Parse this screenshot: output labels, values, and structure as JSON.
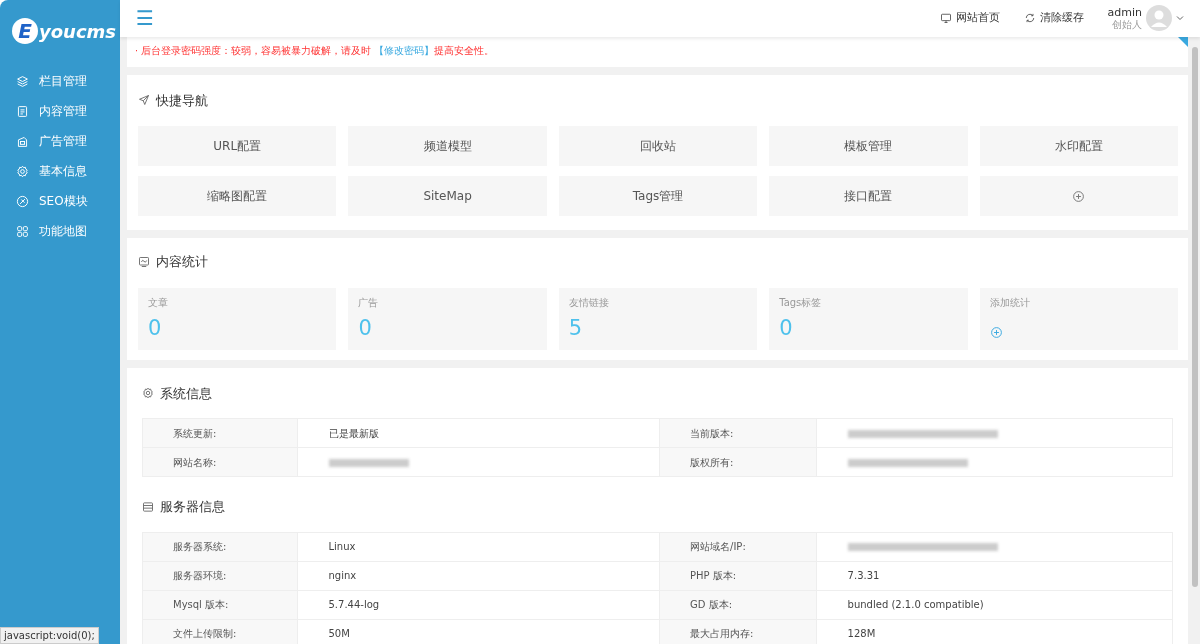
{
  "sidebar": {
    "logo": "youcms",
    "logo_letter": "E",
    "items": [
      {
        "label": "栏目管理",
        "selected": false
      },
      {
        "label": "内容管理",
        "selected": false
      },
      {
        "label": "广告管理",
        "selected": false
      },
      {
        "label": "基本信息",
        "selected": false
      },
      {
        "label": "SEO模块",
        "selected": false
      },
      {
        "label": "功能地图",
        "selected": false
      }
    ]
  },
  "topbar": {
    "menu_icon": "☰",
    "links": [
      {
        "label": "网站首页"
      },
      {
        "label": "清除缓存"
      }
    ],
    "user": {
      "name": "admin",
      "role": "创始人"
    }
  },
  "notice": {
    "bullet": "·",
    "text": "后台登录密码强度：较弱，容易被暴力破解，请及时",
    "link": "【修改密码】",
    "after": "提高安全性。"
  },
  "quick_nav": {
    "title": "快捷导航",
    "items": [
      {
        "label": "URL配置",
        "kind": "text"
      },
      {
        "label": "频道模型",
        "kind": "text"
      },
      {
        "label": "回收站",
        "kind": "text"
      },
      {
        "label": "模板管理",
        "kind": "text"
      },
      {
        "label": "水印配置",
        "kind": "text"
      },
      {
        "label": "缩略图配置",
        "kind": "text"
      },
      {
        "label": "SiteMap",
        "kind": "text"
      },
      {
        "label": "Tags管理",
        "kind": "text"
      },
      {
        "label": "接口配置",
        "kind": "text"
      },
      {
        "kind": "add"
      }
    ]
  },
  "stats": {
    "title": "内容统计",
    "items": [
      {
        "label": "文章",
        "value": "0",
        "kind": "count"
      },
      {
        "label": "广告",
        "value": "0",
        "kind": "count"
      },
      {
        "label": "友情链接",
        "value": "5",
        "kind": "count"
      },
      {
        "label": "Tags标签",
        "value": "0",
        "kind": "count"
      },
      {
        "label": "添加统计",
        "kind": "add"
      }
    ]
  },
  "system_info": {
    "title": "系统信息",
    "rows": [
      [
        {
          "label": "系统更新:",
          "kind": "text",
          "value": "已是最新版"
        },
        {
          "label": "当前版本:",
          "kind": "blurred"
        }
      ],
      [
        {
          "label": "网站名称:",
          "kind": "blurred"
        },
        {
          "label": "版权所有:",
          "kind": "blurred"
        }
      ]
    ]
  },
  "server_info": {
    "title": "服务器信息",
    "rows": [
      [
        {
          "label": "服务器系统:",
          "kind": "text",
          "value": "Linux"
        },
        {
          "label": "网站域名/IP:",
          "kind": "blurred"
        }
      ],
      [
        {
          "label": "服务器环境:",
          "kind": "text",
          "value": "nginx"
        },
        {
          "label": "PHP 版本:",
          "kind": "text",
          "value": "7.3.31"
        }
      ],
      [
        {
          "label": "Mysql 版本:",
          "kind": "text",
          "value": "5.7.44-log"
        },
        {
          "label": "GD 版本:",
          "kind": "text",
          "value": "bundled (2.1.0 compatible)"
        }
      ],
      [
        {
          "label": "文件上传限制:",
          "kind": "text",
          "value": "50M"
        },
        {
          "label": "最大占用内存:",
          "kind": "text",
          "value": "128M"
        }
      ]
    ]
  },
  "status_bar": "javascript:void(0);"
}
